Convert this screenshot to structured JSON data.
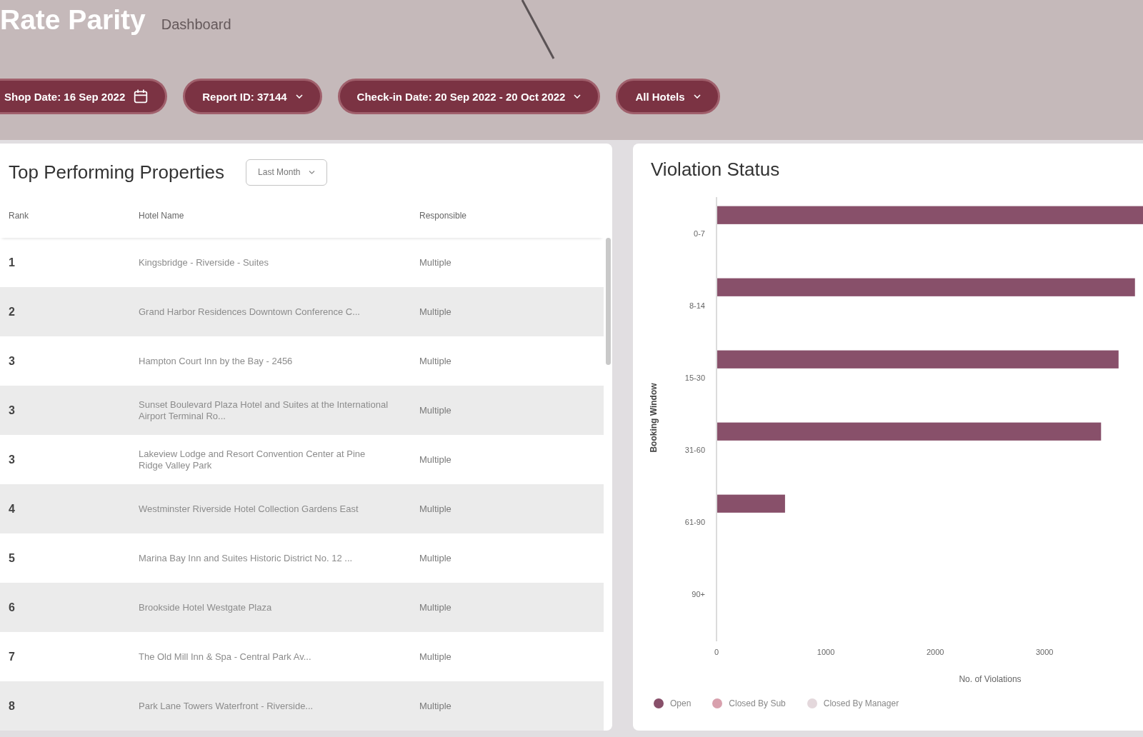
{
  "header": {
    "title": "Rate Parity",
    "subtitle": "Dashboard"
  },
  "filters": [
    {
      "kind": "date",
      "label": "Shop Date: 16 Sep 2022"
    },
    {
      "kind": "dropdown",
      "label": "Report ID: 37144"
    },
    {
      "kind": "dropdown",
      "label": "Check-in Date: 20 Sep 2022 - 20 Oct 2022"
    },
    {
      "kind": "dropdown",
      "label": "All Hotels"
    }
  ],
  "top_properties": {
    "title": "Top Performing Properties",
    "period": {
      "value": "Last Month"
    },
    "columns": [
      "Rank",
      "Hotel Name",
      "Responsible"
    ],
    "rows": [
      {
        "rank": "1",
        "hotel_name": "Kingsbridge - Riverside - Suites",
        "responsible": "Multiple"
      },
      {
        "rank": "2",
        "hotel_name": "Grand Harbor Residences Downtown Conference C...",
        "responsible": "Multiple"
      },
      {
        "rank": "3",
        "hotel_name": "Hampton Court Inn by the Bay - 2456",
        "responsible": "Multiple"
      },
      {
        "rank": "3",
        "hotel_name": "Sunset Boulevard Plaza Hotel and Suites at the International Airport Terminal Ro...",
        "responsible": "Multiple"
      },
      {
        "rank": "3",
        "hotel_name": "Lakeview Lodge and Resort Convention Center at Pine Ridge Valley Park",
        "responsible": "Multiple"
      },
      {
        "rank": "4",
        "hotel_name": "Westminster Riverside Hotel Collection Gardens East",
        "responsible": "Multiple"
      },
      {
        "rank": "5",
        "hotel_name": "Marina Bay Inn and Suites Historic District No. 12 ...",
        "responsible": "Multiple"
      },
      {
        "rank": "6",
        "hotel_name": "Brookside Hotel Westgate Plaza",
        "responsible": "Multiple"
      },
      {
        "rank": "7",
        "hotel_name": "The Old Mill Inn & Spa - Central Park Av...",
        "responsible": "Multiple"
      },
      {
        "rank": "8",
        "hotel_name": "Park Lane Towers Waterfront - Riverside...",
        "responsible": "Multiple"
      }
    ]
  },
  "violation_status": {
    "title": "Violation Status",
    "chart_data": [
      {
        "type": "bar",
        "orientation": "horizontal",
        "ylabel": "Booking Window",
        "xlabel": "No. of Violations",
        "categories": [
          "0-7",
          "8-14",
          "15-30",
          "31-60",
          "61-90",
          "90+"
        ],
        "xticks": [
          0,
          1000,
          2000,
          3000
        ],
        "xlim": [
          0,
          3900
        ],
        "legend": "bottom",
        "series": [
          {
            "name": "Open",
            "color": "#88506a",
            "values": [
              3900,
              3820,
              3670,
              3510,
              620,
              0
            ]
          },
          {
            "name": "Closed By Sub",
            "color": "#d8a0ad",
            "values": [
              0,
              0,
              0,
              0,
              0,
              0
            ]
          },
          {
            "name": "Closed By Manager",
            "color": "#e4d8dc",
            "values": [
              0,
              0,
              0,
              0,
              0,
              0
            ]
          }
        ]
      }
    ]
  }
}
